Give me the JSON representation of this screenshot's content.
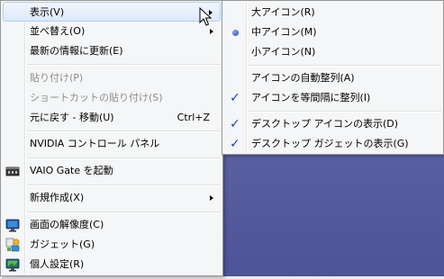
{
  "main_menu": {
    "items": [
      {
        "label": "表示(V)",
        "submenu": true
      },
      {
        "label": "並べ替え(O)",
        "submenu": true
      },
      {
        "label": "最新の情報に更新(E)"
      },
      {
        "label": "貼り付け(P)"
      },
      {
        "label": "ショートカットの貼り付け(S)"
      },
      {
        "label": "元に戻す - 移動(U)",
        "shortcut": "Ctrl+Z"
      },
      {
        "label": "NVIDIA コントロール パネル"
      },
      {
        "label": "VAIO Gate を起動"
      },
      {
        "label": "新規作成(X)",
        "submenu": true
      },
      {
        "label": "画面の解像度(C)"
      },
      {
        "label": "ガジェット(G)"
      },
      {
        "label": "個人設定(R)"
      }
    ]
  },
  "view_submenu": {
    "items": [
      {
        "label": "大アイコン(R)"
      },
      {
        "label": "中アイコン(M)",
        "selected": true
      },
      {
        "label": "小アイコン(N)"
      },
      {
        "label": "アイコンの自動整列(A)"
      },
      {
        "label": "アイコンを等間隔に整列(I)",
        "checked": true
      },
      {
        "label": "デスクトップ アイコンの表示(D)",
        "checked": true
      },
      {
        "label": "デスクトップ ガジェットの表示(G)",
        "checked": true
      }
    ]
  },
  "glyphs": {
    "check": "✓"
  }
}
